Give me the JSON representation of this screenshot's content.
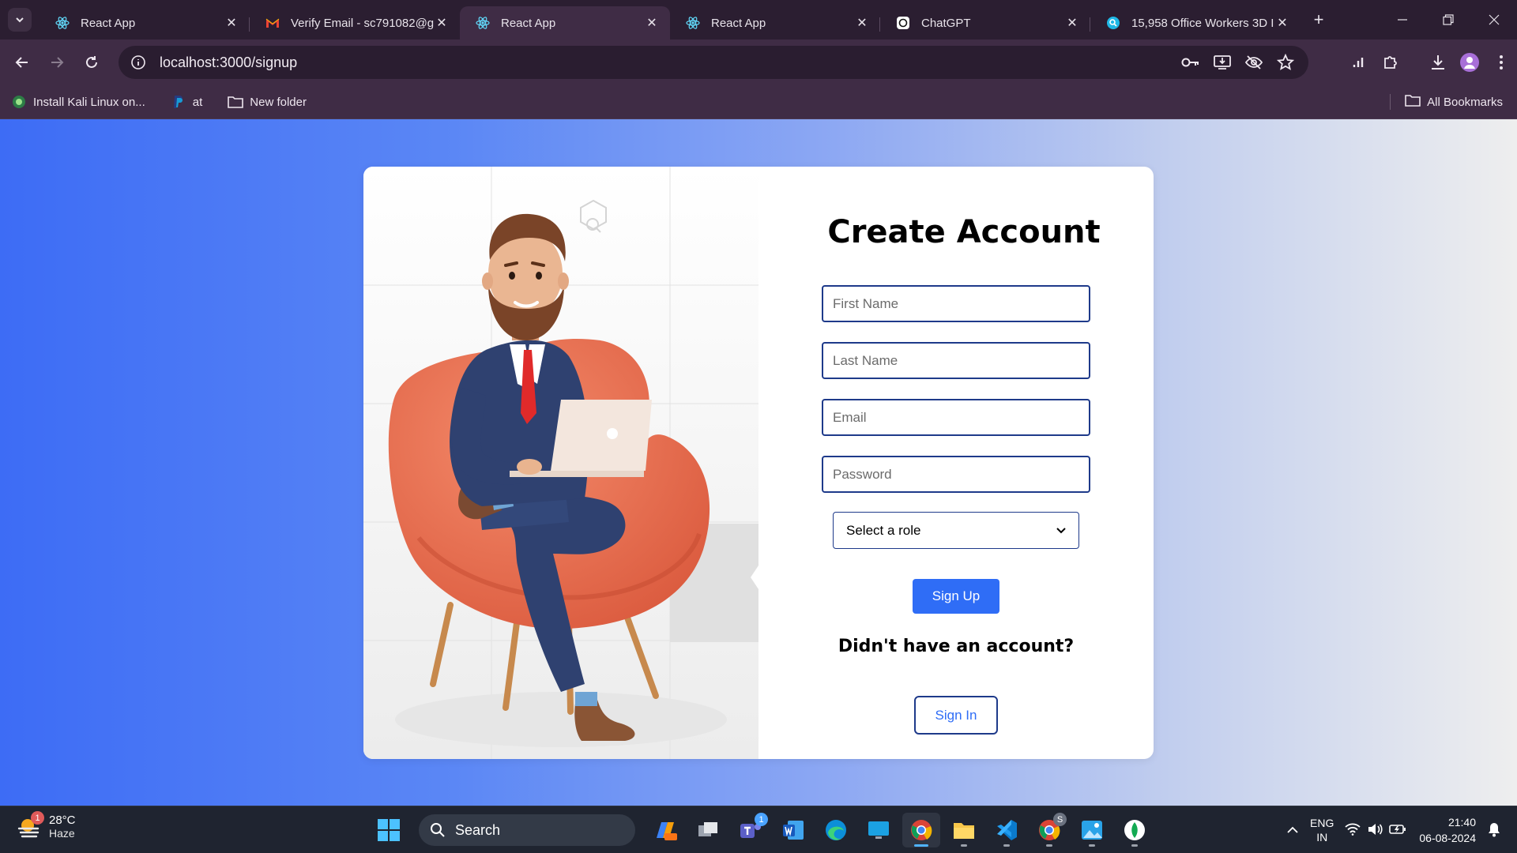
{
  "browser": {
    "tabs": [
      {
        "title": "React App",
        "icon": "react-icon",
        "active": false
      },
      {
        "title": "Verify Email - sc791082@g",
        "icon": "gmail-icon",
        "active": false
      },
      {
        "title": "React App",
        "icon": "react-icon",
        "active": true
      },
      {
        "title": "React App",
        "icon": "react-icon",
        "active": false
      },
      {
        "title": "ChatGPT",
        "icon": "chatgpt-icon",
        "active": false
      },
      {
        "title": "15,958 Office Workers 3D I",
        "icon": "search-site-icon",
        "active": false
      }
    ],
    "url": "localhost:3000/signup",
    "bookmarks": [
      {
        "label": "Install Kali Linux on...",
        "icon": "kali-icon"
      },
      {
        "label": "at",
        "icon": "paypal-icon"
      },
      {
        "label": "New folder",
        "icon": "folder-icon"
      }
    ],
    "all_bookmarks": "All Bookmarks"
  },
  "signup": {
    "title": "Create Account",
    "first_name_placeholder": "First Name",
    "last_name_placeholder": "Last Name",
    "email_placeholder": "Email",
    "password_placeholder": "Password",
    "role_select": "Select a role",
    "signup_button": "Sign Up",
    "question": "Didn't have an account?",
    "signin_button": "Sign In"
  },
  "taskbar": {
    "weather_temp": "28°C",
    "weather_desc": "Haze",
    "weather_badge": "1",
    "search_label": "Search",
    "teams_badge": "1",
    "chrome_badge": "S",
    "lang_line1": "ENG",
    "lang_line2": "IN",
    "time": "21:40",
    "date": "06-08-2024"
  },
  "colors": {
    "accent": "#2f6df6",
    "border": "#1e3a8a",
    "chrome_frame": "#3f2c45",
    "chair": "#e8684a"
  }
}
